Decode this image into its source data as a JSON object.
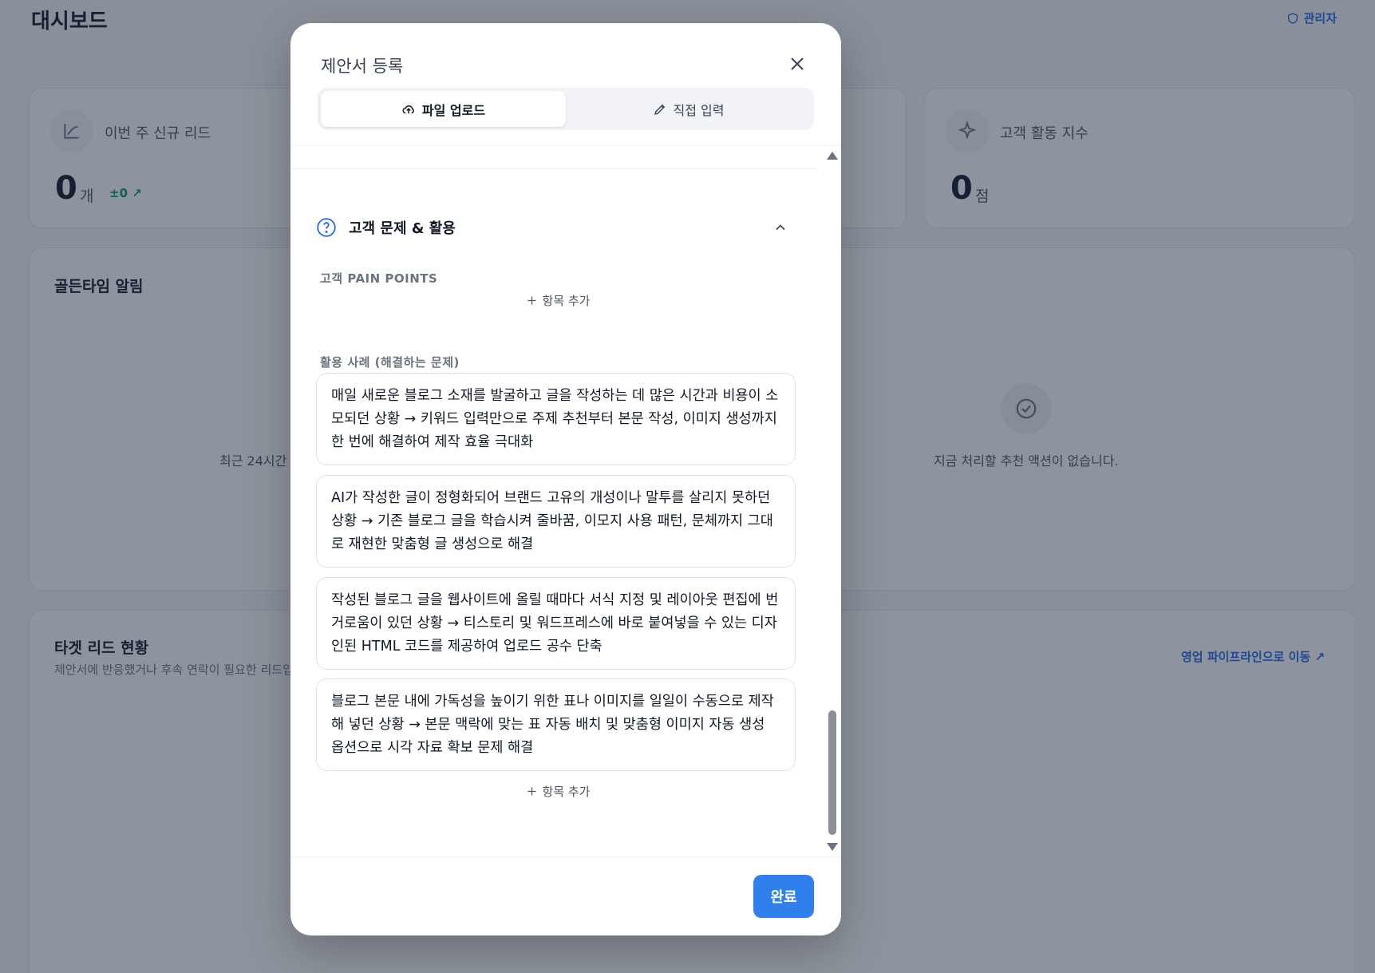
{
  "dashboard": {
    "title": "대시보드",
    "admin_label": "관리자",
    "stats": [
      {
        "label": "이번 주 신규 리드",
        "value": "0",
        "unit": "개",
        "delta": "±0 ↗"
      },
      {
        "label": "고객 활동 지수",
        "value": "0",
        "unit": "점"
      }
    ],
    "golden_time": {
      "title": "골든타임 알림",
      "left_fragment": "최근 24시간",
      "empty_text": "지금 처리할 추천 액션이 없습니다."
    },
    "target_leads": {
      "title": "타겟 리드 현황",
      "subtitle": "제안서에 반응했거나 후속 연락이 필요한 리드입",
      "pipeline_link": "영업 파이프라인으로 이동 ↗"
    }
  },
  "modal": {
    "title": "제안서 등록",
    "tabs": [
      {
        "label": "파일 업로드",
        "active": true
      },
      {
        "label": "직접 입력",
        "active": false
      }
    ],
    "section": {
      "title": "고객 문제 & 활용",
      "pain_points_label": "고객 PAIN POINTS",
      "add_item_label": "항목 추가",
      "use_cases_label": "활용 사례 (해결하는 문제)",
      "use_cases": [
        "매일 새로운 블로그 소재를 발굴하고 글을 작성하는 데 많은 시간과 비용이 소모되던 상황 → 키워드 입력만으로 주제 추천부터 본문 작성, 이미지 생성까지 한 번에 해결하여 제작 효율 극대화",
        "AI가 작성한 글이 정형화되어 브랜드 고유의 개성이나 말투를 살리지 못하던 상황 → 기존 블로그 글을 학습시켜 줄바꿈, 이모지 사용 패턴, 문체까지 그대로 재현한 맞춤형 글 생성으로 해결",
        "작성된 블로그 글을 웹사이트에 올릴 때마다 서식 지정 및 레이아웃 편집에 번거로움이 있던 상황 → 티스토리 및 워드프레스에 바로 붙여넣을 수 있는 디자인된 HTML 코드를 제공하여 업로드 공수 단축",
        "블로그 본문 내에 가독성을 높이기 위한 표나 이미지를 일일이 수동으로 제작해 넣던 상황 → 본문 맥락에 맞는 표 자동 배치 및 맞춤형 이미지 자동 생성 옵션으로 시각 자료 확보 문제 해결"
      ],
      "add_item_label_2": "항목 추가"
    },
    "done_label": "완료"
  }
}
